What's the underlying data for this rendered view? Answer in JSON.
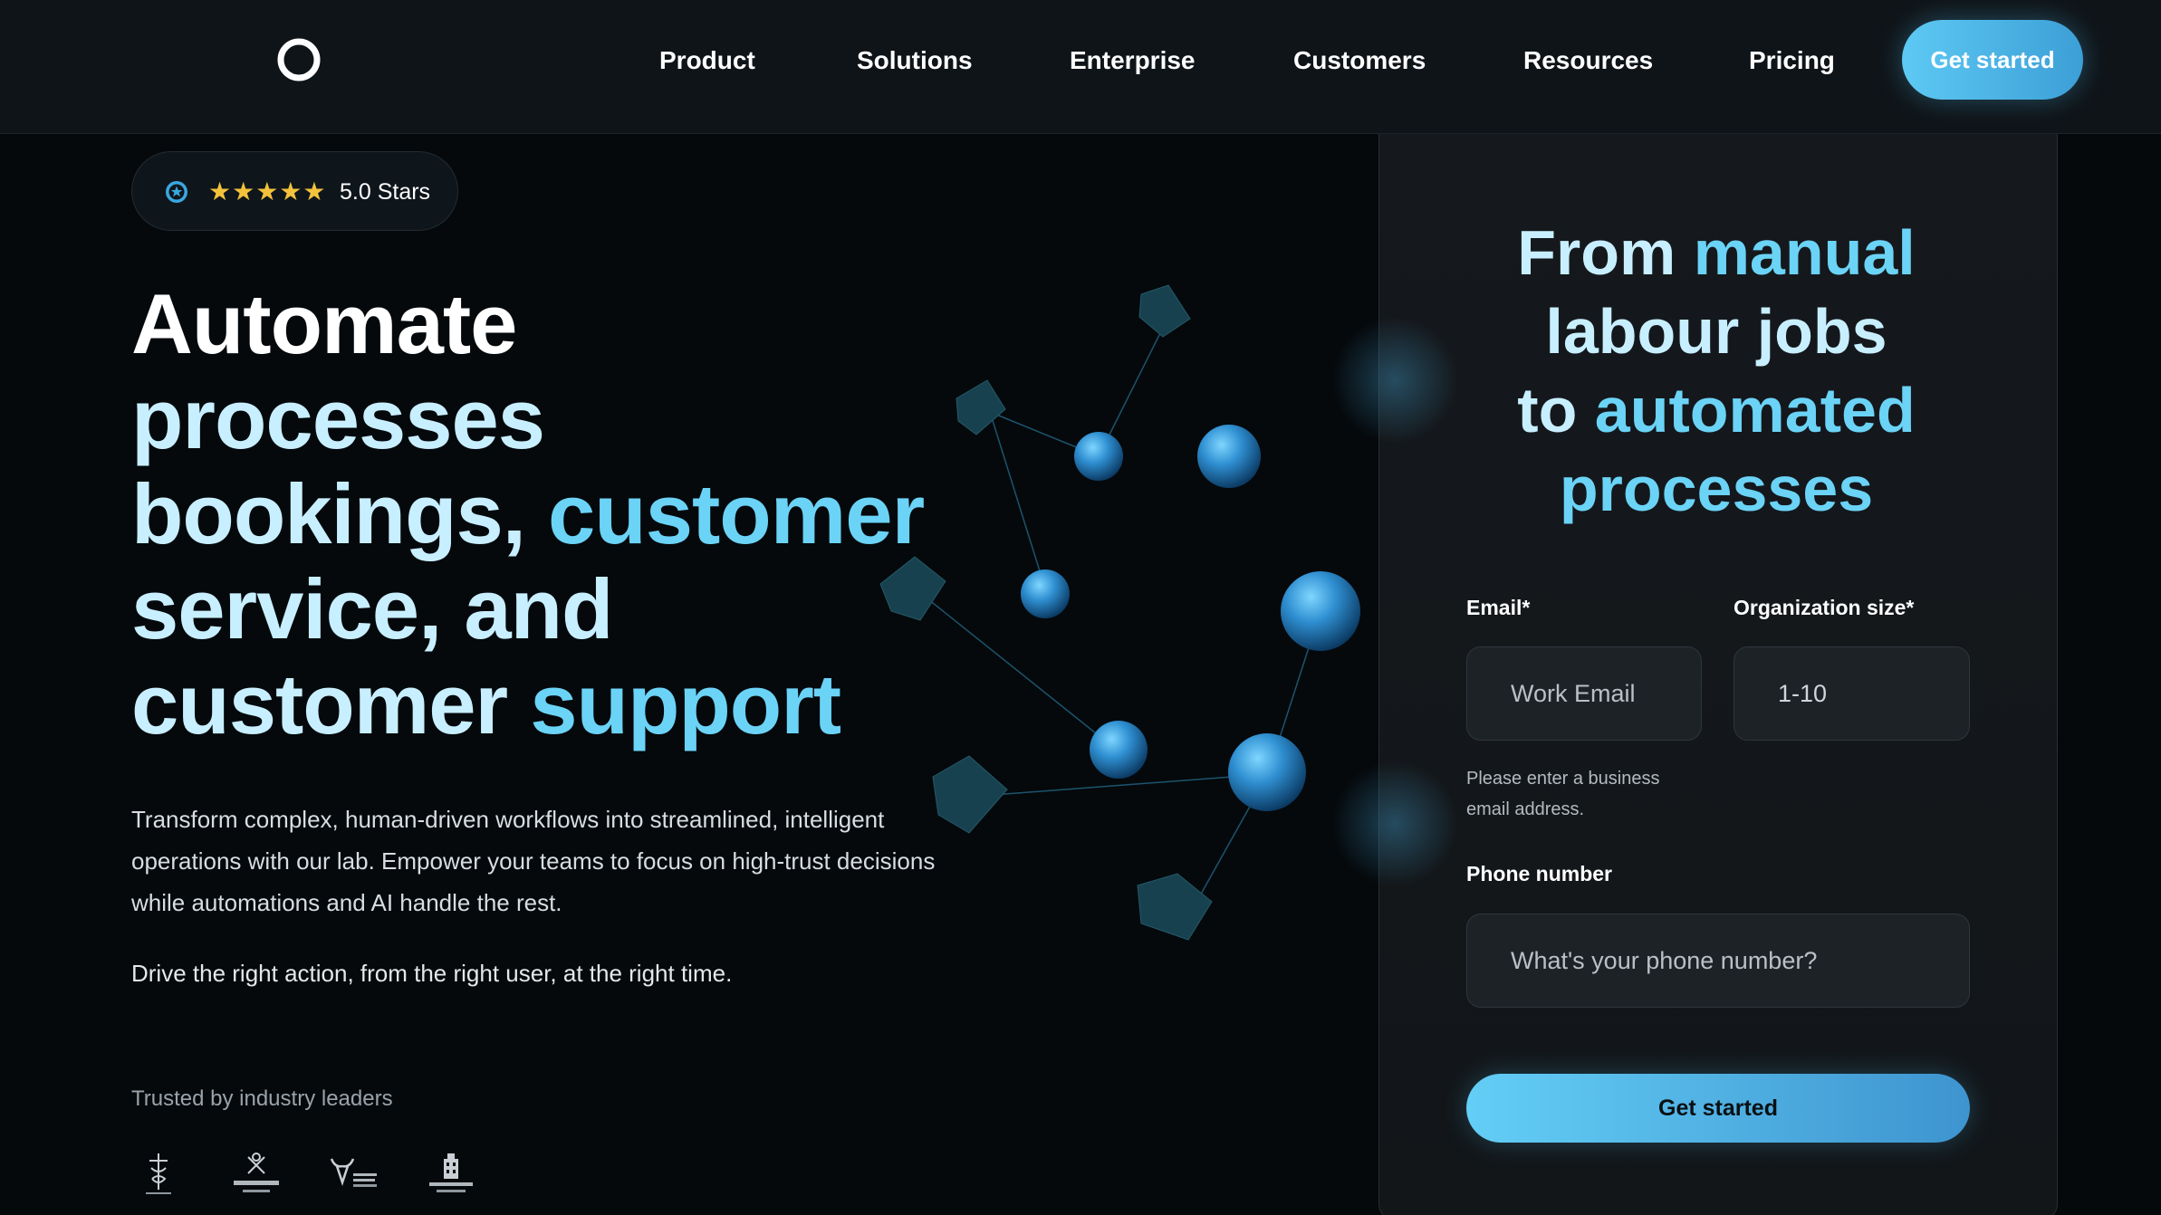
{
  "nav": {
    "logo": "ring-logo-icon",
    "links": [
      "Product",
      "Solutions",
      "Enterprise",
      "Customers",
      "Resources",
      "Pricing"
    ],
    "cta_label": "Get started"
  },
  "rating": {
    "icon": "star-badge-icon",
    "stars": "★★★★★",
    "label": "5.0 Stars"
  },
  "hero": {
    "headline_1": "Automate",
    "headline_2": "processes",
    "headline_3a": "bookings,",
    "headline_3b": "customer",
    "headline_4": "service, and",
    "headline_5a": "customer",
    "headline_5b": "support",
    "description": "Transform complex, human-driven workflows into streamlined, intelligent operations with our lab. Empower your teams to focus on high-trust decisions while automations and AI handle the rest.",
    "tagline": "Drive the right action, from the right user, at the right time.",
    "trusted_label": "Trusted by industry leaders",
    "client_logos": [
      "client-logo-1",
      "client-logo-kavanaugh",
      "client-logo-bull",
      "client-logo-ellingsworth"
    ]
  },
  "form": {
    "title_1a": "From",
    "title_1b": "manual",
    "title_2": "labour jobs",
    "title_3a": "to",
    "title_3b": "automated",
    "title_4": "processes",
    "email_label": "Email*",
    "email_placeholder": "Work Email",
    "org_label": "Organization size*",
    "org_value": "1-10",
    "hint": "Please enter a business email address.",
    "phone_label": "Phone number",
    "phone_placeholder": "What's your phone number?",
    "submit_label": "Get started"
  },
  "colors": {
    "accent": "#5ec9f4",
    "accent_dark": "#3c9fd6",
    "background": "#05090c",
    "panel": "#15191d",
    "star": "#f3c23c"
  }
}
